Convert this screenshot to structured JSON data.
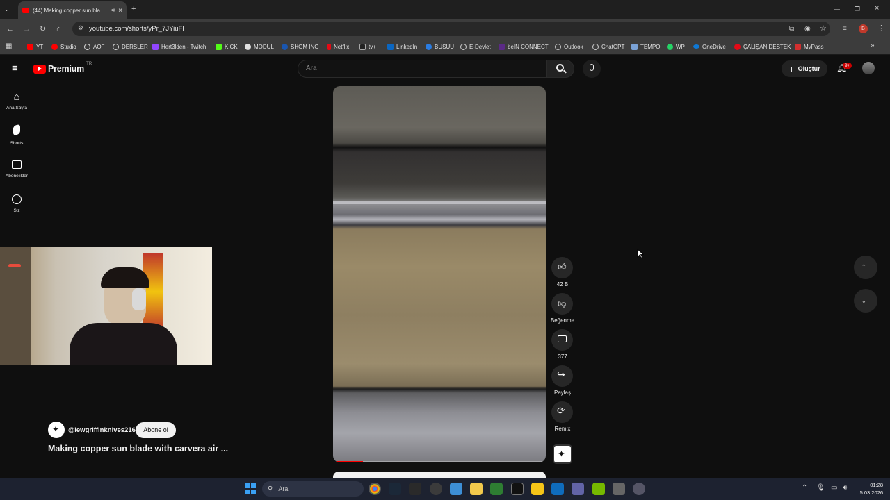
{
  "browser": {
    "tab_title": "(44) Making copper sun bla",
    "url": "youtube.com/shorts/yPr_7JYiuFI",
    "bookmarks": [
      "YT",
      "Studio",
      "AÖF",
      "DERSLER",
      "Hert3lden - Twitch",
      "KİCK",
      "MODÜL",
      "SHGM İNG",
      "Netflix",
      "tv+",
      "LinkedIn",
      "BUSUU",
      "E-Devlet",
      "beIN CONNECT",
      "Outlook",
      "ChatGPT",
      "TEMPO",
      "WP",
      "OneDrive",
      "ÇALIŞAN DESTEK",
      "MyPass"
    ],
    "profile_initial": "B",
    "colors": {
      "tab_strip": "#1f1f1f",
      "toolbar": "#3c3c3c",
      "accent_red": "#ff0000"
    }
  },
  "youtube": {
    "logo_text": "Premium",
    "logo_region": "TR",
    "search_placeholder": "Ara",
    "create_label": "Oluştur",
    "notif_count": "9+",
    "sidebar": [
      {
        "label": "Ana Sayfa",
        "icon": "home-icon"
      },
      {
        "label": "Shorts",
        "icon": "shorts-icon"
      },
      {
        "label": "Abonelikler",
        "icon": "subscriptions-icon"
      },
      {
        "label": "Siz",
        "icon": "you-icon"
      }
    ],
    "actions": {
      "likes": "42 B",
      "dislike_label": "Beğenme",
      "comments": "377",
      "share_label": "Paylaş",
      "remix_label": "Remix"
    },
    "channel": {
      "handle": "@lewgriffinknives216",
      "subscribe_label": "Abone ol"
    },
    "video_title": "Making copper sun blade with carvera air ..."
  },
  "taskbar": {
    "search_placeholder": "Ara",
    "time": "01:28",
    "date": "5.03.2026"
  }
}
